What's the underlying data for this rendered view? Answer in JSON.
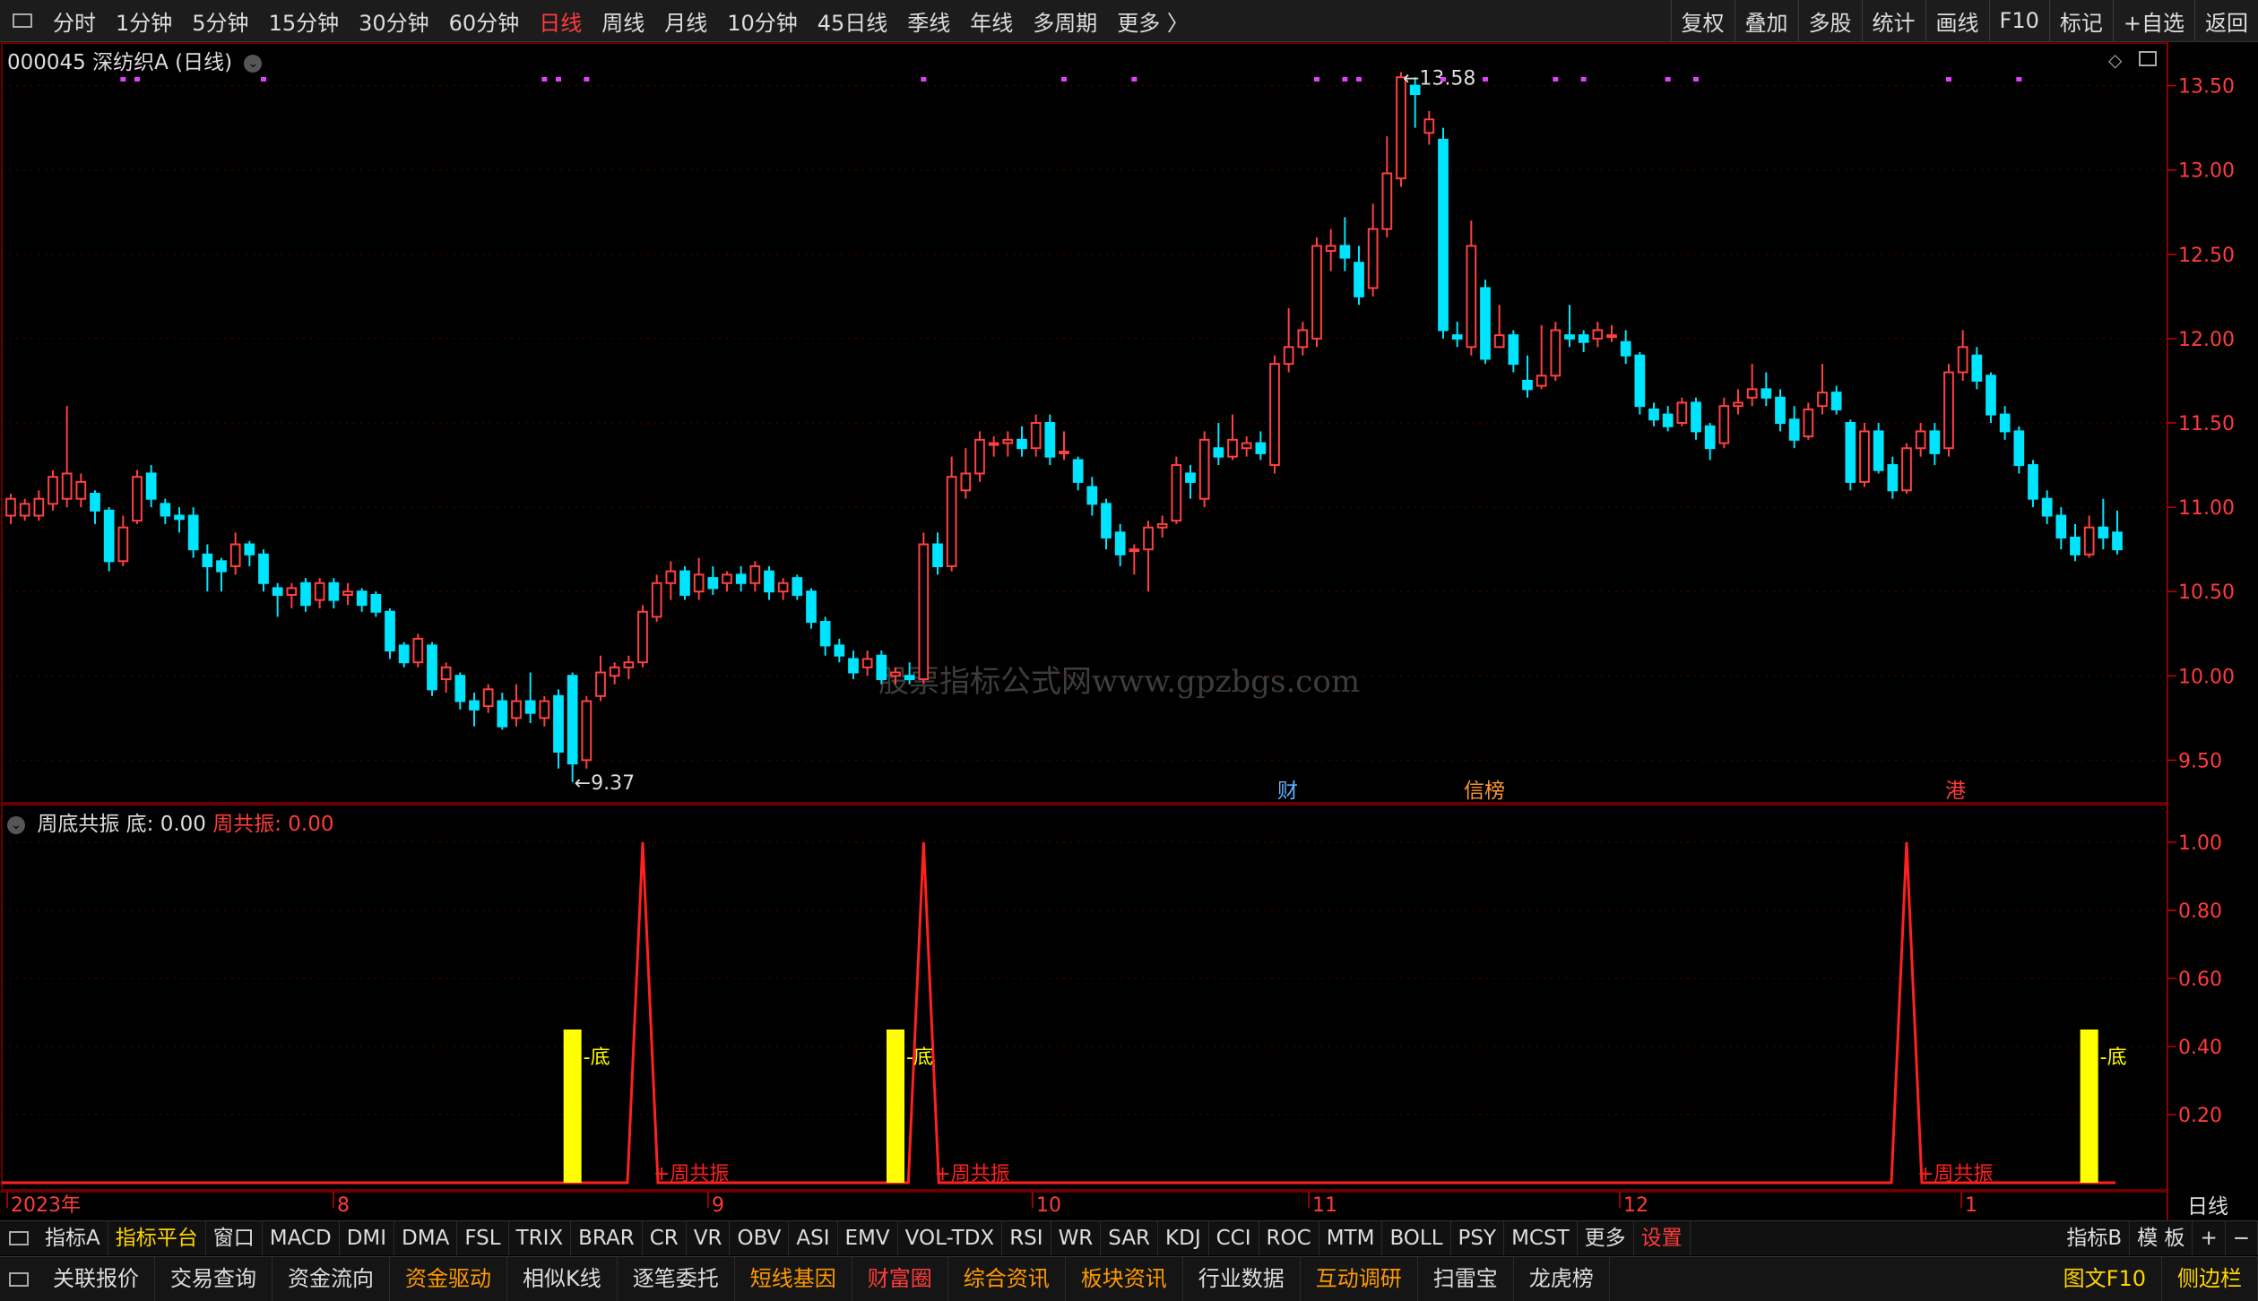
{
  "toolbar": {
    "periods": [
      "分时",
      "1分钟",
      "5分钟",
      "15分钟",
      "30分钟",
      "60分钟",
      "日线",
      "周线",
      "月线",
      "10分钟",
      "45日线",
      "季线",
      "年线",
      "多周期",
      "更多 〉"
    ],
    "active_period": "日线",
    "right_buttons": [
      "复权",
      "叠加",
      "多股",
      "统计",
      "画线",
      "F10",
      "标记",
      "+自选",
      "返回"
    ]
  },
  "chart_title": "000045 深纺织A (日线)",
  "watermark": "股票指标公式网www.gpzbgs.com",
  "price_axis": {
    "ticks": [
      "13.50",
      "13.00",
      "12.50",
      "12.00",
      "11.50",
      "11.00",
      "10.50",
      "10.00",
      "9.50"
    ],
    "high_label": "13.58",
    "low_label": "9.37"
  },
  "event_markers": [
    {
      "label": "财",
      "color": "#5fb2ff"
    },
    {
      "label": "信榜",
      "color": "#ff9933"
    },
    {
      "label": "港",
      "color": "#ff3b3b"
    }
  ],
  "indicator": {
    "name": "周底共振",
    "line1_label": "底:",
    "line1_value": "0.00",
    "line2_label": "周共振:",
    "line2_value": "0.00",
    "axis_ticks": [
      "1.00",
      "0.80",
      "0.60",
      "0.40",
      "0.20"
    ],
    "bottom_label": "底",
    "resonance_label": "周共振"
  },
  "date_axis": {
    "labels": [
      "2023年",
      "8",
      "9",
      "10",
      "11",
      "12",
      "1"
    ],
    "period_label": "日线"
  },
  "colors": {
    "up": "#ff4040",
    "down": "#00e5ff",
    "accent": "#ff3b3b",
    "yellow": "#ffff00",
    "grid": "#5a0000"
  },
  "chart_data": {
    "type": "candlestick",
    "ylim": [
      9.3,
      13.7
    ],
    "candles": [
      [
        10.95,
        11.05,
        10.9,
        11.08
      ],
      [
        10.95,
        11.02,
        10.92,
        11.05
      ],
      [
        10.95,
        11.05,
        10.92,
        11.1
      ],
      [
        11.02,
        11.18,
        10.98,
        11.22
      ],
      [
        11.05,
        11.2,
        11.0,
        11.6
      ],
      [
        11.05,
        11.15,
        11.0,
        11.2
      ],
      [
        11.08,
        10.98,
        10.9,
        11.1
      ],
      [
        10.98,
        10.68,
        10.62,
        11.0
      ],
      [
        10.68,
        10.88,
        10.65,
        10.95
      ],
      [
        10.92,
        11.18,
        10.9,
        11.22
      ],
      [
        11.2,
        11.05,
        11.0,
        11.25
      ],
      [
        11.02,
        10.95,
        10.9,
        11.05
      ],
      [
        10.95,
        10.93,
        10.85,
        11.0
      ],
      [
        10.95,
        10.75,
        10.7,
        11.0
      ],
      [
        10.72,
        10.65,
        10.5,
        10.78
      ],
      [
        10.68,
        10.62,
        10.5,
        10.7
      ],
      [
        10.65,
        10.78,
        10.6,
        10.85
      ],
      [
        10.78,
        10.72,
        10.65,
        10.8
      ],
      [
        10.72,
        10.55,
        10.5,
        10.75
      ],
      [
        10.52,
        10.48,
        10.35,
        10.55
      ],
      [
        10.48,
        10.52,
        10.4,
        10.55
      ],
      [
        10.55,
        10.42,
        10.38,
        10.58
      ],
      [
        10.45,
        10.55,
        10.4,
        10.58
      ],
      [
        10.55,
        10.45,
        10.4,
        10.58
      ],
      [
        10.48,
        10.5,
        10.42,
        10.55
      ],
      [
        10.5,
        10.42,
        10.38,
        10.52
      ],
      [
        10.48,
        10.38,
        10.35,
        10.5
      ],
      [
        10.38,
        10.15,
        10.1,
        10.4
      ],
      [
        10.18,
        10.08,
        10.05,
        10.2
      ],
      [
        10.08,
        10.22,
        10.05,
        10.25
      ],
      [
        10.18,
        9.92,
        9.88,
        10.2
      ],
      [
        9.98,
        10.05,
        9.9,
        10.08
      ],
      [
        10.0,
        9.85,
        9.8,
        10.02
      ],
      [
        9.85,
        9.8,
        9.7,
        9.9
      ],
      [
        9.82,
        9.92,
        9.78,
        9.95
      ],
      [
        9.85,
        9.7,
        9.68,
        9.9
      ],
      [
        9.75,
        9.85,
        9.7,
        9.95
      ],
      [
        9.85,
        9.78,
        9.72,
        10.02
      ],
      [
        9.75,
        9.85,
        9.7,
        9.88
      ],
      [
        9.88,
        9.55,
        9.45,
        9.92
      ],
      [
        10.0,
        9.48,
        9.37,
        10.02
      ],
      [
        9.5,
        9.85,
        9.45,
        9.88
      ],
      [
        9.88,
        10.02,
        9.85,
        10.12
      ],
      [
        10.0,
        10.05,
        9.95,
        10.08
      ],
      [
        10.05,
        10.08,
        9.98,
        10.12
      ],
      [
        10.08,
        10.38,
        10.05,
        10.42
      ],
      [
        10.35,
        10.55,
        10.32,
        10.6
      ],
      [
        10.55,
        10.62,
        10.45,
        10.68
      ],
      [
        10.62,
        10.48,
        10.45,
        10.65
      ],
      [
        10.5,
        10.6,
        10.45,
        10.7
      ],
      [
        10.58,
        10.52,
        10.48,
        10.65
      ],
      [
        10.55,
        10.6,
        10.5,
        10.62
      ],
      [
        10.6,
        10.55,
        10.5,
        10.65
      ],
      [
        10.55,
        10.65,
        10.5,
        10.68
      ],
      [
        10.62,
        10.5,
        10.45,
        10.65
      ],
      [
        10.5,
        10.55,
        10.45,
        10.58
      ],
      [
        10.58,
        10.48,
        10.45,
        10.6
      ],
      [
        10.5,
        10.32,
        10.28,
        10.52
      ],
      [
        10.32,
        10.18,
        10.12,
        10.35
      ],
      [
        10.18,
        10.12,
        10.08,
        10.22
      ],
      [
        10.1,
        10.02,
        9.98,
        10.15
      ],
      [
        10.05,
        10.1,
        10.0,
        10.15
      ],
      [
        10.12,
        9.98,
        9.95,
        10.15
      ],
      [
        10.0,
        10.02,
        9.95,
        10.05
      ],
      [
        10.0,
        9.98,
        9.95,
        10.08
      ],
      [
        9.98,
        10.78,
        9.95,
        10.85
      ],
      [
        10.78,
        10.65,
        10.6,
        10.85
      ],
      [
        10.65,
        11.18,
        10.62,
        11.3
      ],
      [
        11.1,
        11.2,
        11.05,
        11.35
      ],
      [
        11.2,
        11.4,
        11.15,
        11.45
      ],
      [
        11.38,
        11.38,
        11.3,
        11.42
      ],
      [
        11.38,
        11.4,
        11.3,
        11.45
      ],
      [
        11.4,
        11.35,
        11.3,
        11.48
      ],
      [
        11.35,
        11.5,
        11.3,
        11.55
      ],
      [
        11.5,
        11.3,
        11.25,
        11.55
      ],
      [
        11.32,
        11.33,
        11.28,
        11.45
      ],
      [
        11.28,
        11.15,
        11.1,
        11.3
      ],
      [
        11.12,
        11.02,
        10.95,
        11.18
      ],
      [
        11.02,
        10.82,
        10.75,
        11.05
      ],
      [
        10.85,
        10.72,
        10.65,
        10.9
      ],
      [
        10.75,
        10.75,
        10.6,
        10.78
      ],
      [
        10.75,
        10.88,
        10.5,
        10.92
      ],
      [
        10.88,
        10.9,
        10.82,
        10.95
      ],
      [
        10.92,
        11.25,
        10.9,
        11.3
      ],
      [
        11.2,
        11.15,
        11.05,
        11.25
      ],
      [
        11.05,
        11.4,
        11.0,
        11.45
      ],
      [
        11.35,
        11.3,
        11.25,
        11.5
      ],
      [
        11.3,
        11.4,
        11.28,
        11.55
      ],
      [
        11.35,
        11.38,
        11.3,
        11.42
      ],
      [
        11.38,
        11.32,
        11.28,
        11.45
      ],
      [
        11.25,
        11.85,
        11.2,
        11.9
      ],
      [
        11.85,
        11.95,
        11.8,
        12.18
      ],
      [
        11.95,
        12.05,
        11.9,
        12.1
      ],
      [
        12.0,
        12.55,
        11.95,
        12.6
      ],
      [
        12.52,
        12.55,
        12.4,
        12.65
      ],
      [
        12.55,
        12.48,
        12.4,
        12.72
      ],
      [
        12.45,
        12.25,
        12.2,
        12.55
      ],
      [
        12.3,
        12.65,
        12.25,
        12.8
      ],
      [
        12.65,
        12.98,
        12.6,
        13.2
      ],
      [
        12.95,
        13.55,
        12.9,
        13.58
      ],
      [
        13.5,
        13.45,
        13.25,
        13.55
      ],
      [
        13.22,
        13.3,
        13.15,
        13.35
      ],
      [
        13.18,
        12.05,
        12.0,
        13.25
      ],
      [
        12.02,
        12.0,
        11.95,
        12.1
      ],
      [
        11.95,
        12.55,
        11.9,
        12.7
      ],
      [
        12.3,
        11.88,
        11.85,
        12.35
      ],
      [
        11.95,
        12.02,
        11.95,
        12.2
      ],
      [
        12.02,
        11.85,
        11.8,
        12.05
      ],
      [
        11.75,
        11.7,
        11.65,
        11.9
      ],
      [
        11.72,
        11.78,
        11.7,
        12.08
      ],
      [
        11.78,
        12.05,
        11.75,
        12.1
      ],
      [
        12.02,
        12.0,
        11.95,
        12.2
      ],
      [
        12.02,
        11.98,
        11.92,
        12.05
      ],
      [
        12.0,
        12.05,
        11.95,
        12.1
      ],
      [
        12.02,
        12.02,
        11.98,
        12.08
      ],
      [
        11.98,
        11.9,
        11.85,
        12.05
      ],
      [
        11.9,
        11.6,
        11.55,
        11.92
      ],
      [
        11.58,
        11.52,
        11.48,
        11.62
      ],
      [
        11.55,
        11.48,
        11.45,
        11.6
      ],
      [
        11.5,
        11.62,
        11.48,
        11.65
      ],
      [
        11.62,
        11.45,
        11.4,
        11.65
      ],
      [
        11.48,
        11.35,
        11.28,
        11.5
      ],
      [
        11.38,
        11.6,
        11.35,
        11.65
      ],
      [
        11.6,
        11.62,
        11.55,
        11.7
      ],
      [
        11.65,
        11.7,
        11.6,
        11.85
      ],
      [
        11.7,
        11.65,
        11.6,
        11.8
      ],
      [
        11.65,
        11.5,
        11.45,
        11.7
      ],
      [
        11.52,
        11.4,
        11.35,
        11.6
      ],
      [
        11.42,
        11.58,
        11.4,
        11.62
      ],
      [
        11.6,
        11.68,
        11.55,
        11.85
      ],
      [
        11.68,
        11.58,
        11.55,
        11.72
      ],
      [
        11.5,
        11.15,
        11.1,
        11.52
      ],
      [
        11.15,
        11.45,
        11.12,
        11.5
      ],
      [
        11.45,
        11.22,
        11.2,
        11.5
      ],
      [
        11.25,
        11.1,
        11.05,
        11.3
      ],
      [
        11.1,
        11.35,
        11.08,
        11.38
      ],
      [
        11.35,
        11.45,
        11.3,
        11.5
      ],
      [
        11.45,
        11.32,
        11.25,
        11.5
      ],
      [
        11.35,
        11.8,
        11.3,
        11.85
      ],
      [
        11.8,
        11.95,
        11.75,
        12.05
      ],
      [
        11.9,
        11.75,
        11.7,
        11.95
      ],
      [
        11.78,
        11.55,
        11.5,
        11.8
      ],
      [
        11.55,
        11.45,
        11.4,
        11.6
      ],
      [
        11.45,
        11.25,
        11.2,
        11.48
      ],
      [
        11.25,
        11.05,
        11.0,
        11.28
      ],
      [
        11.05,
        10.95,
        10.9,
        11.1
      ],
      [
        10.95,
        10.82,
        10.75,
        11.0
      ],
      [
        10.82,
        10.72,
        10.68,
        10.9
      ],
      [
        10.72,
        10.88,
        10.7,
        10.95
      ],
      [
        10.88,
        10.82,
        10.75,
        11.05
      ],
      [
        10.85,
        10.75,
        10.72,
        10.98
      ]
    ],
    "signal_bottom_idx": [
      40,
      63,
      148
    ],
    "signal_resonance_idx": [
      45,
      65,
      135
    ],
    "top_dot_idx": [
      8,
      9,
      18,
      38,
      39,
      41,
      65,
      75,
      80,
      93,
      95,
      96,
      102,
      105,
      110,
      112,
      118,
      120,
      138,
      143
    ]
  }
}
